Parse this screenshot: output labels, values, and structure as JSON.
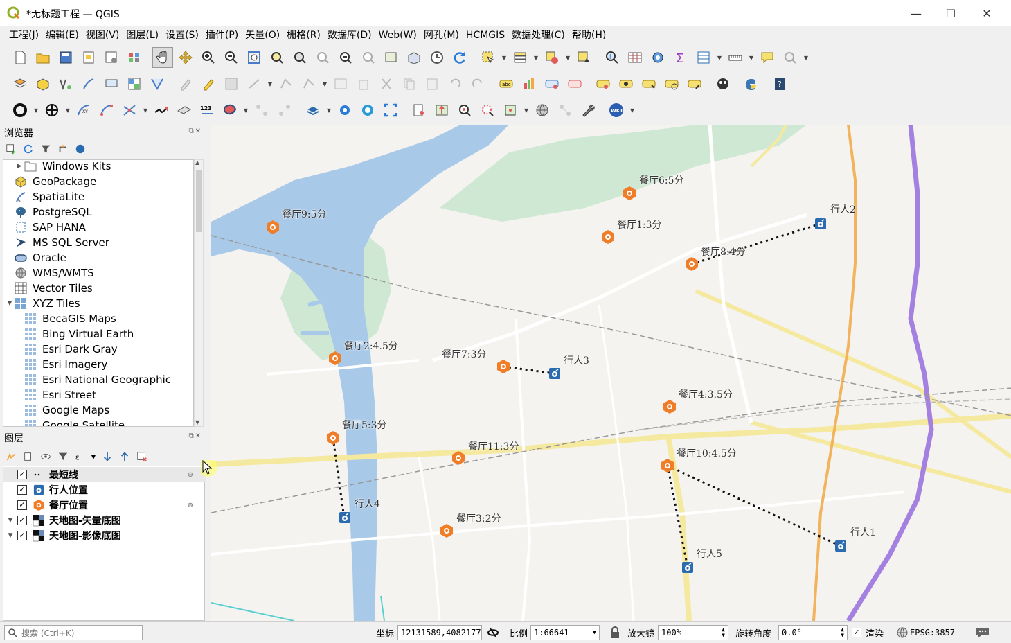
{
  "window": {
    "title": "*无标题工程 — QGIS",
    "minimize": "—",
    "maximize": "☐",
    "close": "✕"
  },
  "menu": [
    "工程(J)",
    "编辑(E)",
    "视图(V)",
    "图层(L)",
    "设置(S)",
    "插件(P)",
    "矢量(O)",
    "栅格(R)",
    "数据库(D)",
    "Web(W)",
    "网孔(M)",
    "HCMGIS",
    "数据处理(C)",
    "帮助(H)"
  ],
  "browser": {
    "title": "浏览器",
    "items": [
      {
        "label": "Windows Kits",
        "icon": "folder-icon",
        "indent": 1,
        "arrow": "▶"
      },
      {
        "label": "GeoPackage",
        "icon": "geopackage-icon",
        "indent": 0,
        "arrow": ""
      },
      {
        "label": "SpatiaLite",
        "icon": "spatialite-icon",
        "indent": 0,
        "arrow": ""
      },
      {
        "label": "PostgreSQL",
        "icon": "postgresql-icon",
        "indent": 0,
        "arrow": ""
      },
      {
        "label": "SAP HANA",
        "icon": "sap-hana-icon",
        "indent": 0,
        "arrow": ""
      },
      {
        "label": "MS SQL Server",
        "icon": "mssql-icon",
        "indent": 0,
        "arrow": ""
      },
      {
        "label": "Oracle",
        "icon": "oracle-icon",
        "indent": 0,
        "arrow": ""
      },
      {
        "label": "WMS/WMTS",
        "icon": "wms-icon",
        "indent": 0,
        "arrow": ""
      },
      {
        "label": "Vector Tiles",
        "icon": "vector-tiles-icon",
        "indent": 0,
        "arrow": ""
      },
      {
        "label": "XYZ Tiles",
        "icon": "xyz-tiles-icon",
        "indent": 0,
        "arrow": "▼"
      },
      {
        "label": "BecaGIS Maps",
        "icon": "tile-icon",
        "indent": 1,
        "arrow": ""
      },
      {
        "label": "Bing Virtual Earth",
        "icon": "tile-icon",
        "indent": 1,
        "arrow": ""
      },
      {
        "label": "Esri Dark Gray",
        "icon": "tile-icon",
        "indent": 1,
        "arrow": ""
      },
      {
        "label": "Esri Imagery",
        "icon": "tile-icon",
        "indent": 1,
        "arrow": ""
      },
      {
        "label": "Esri National Geographic",
        "icon": "tile-icon",
        "indent": 1,
        "arrow": ""
      },
      {
        "label": "Esri Street",
        "icon": "tile-icon",
        "indent": 1,
        "arrow": ""
      },
      {
        "label": "Google Maps",
        "icon": "tile-icon",
        "indent": 1,
        "arrow": ""
      },
      {
        "label": "Google Satellite",
        "icon": "tile-icon",
        "indent": 1,
        "arrow": ""
      }
    ]
  },
  "layers": {
    "title": "图层",
    "items": [
      {
        "label": "最短线",
        "icon": "dotted-line-icon",
        "checked": true,
        "arrow": ""
      },
      {
        "label": "行人位置",
        "icon": "pedestrian-icon",
        "checked": true,
        "arrow": ""
      },
      {
        "label": "餐厅位置",
        "icon": "restaurant-icon",
        "checked": true,
        "arrow": ""
      },
      {
        "label": "天地图-矢量底图",
        "icon": "raster-icon",
        "checked": true,
        "arrow": "▼"
      },
      {
        "label": "天地图-影像底图",
        "icon": "raster-icon",
        "checked": true,
        "arrow": "▼"
      }
    ]
  },
  "map": {
    "restaurants": [
      {
        "label": "餐厅6:5分"
      },
      {
        "label": "餐厅9:5分"
      },
      {
        "label": "餐厅1:3分"
      },
      {
        "label": "餐厅8:4分"
      },
      {
        "label": "餐厅2:4.5分"
      },
      {
        "label": "餐厅7:3分"
      },
      {
        "label": "餐厅4:3.5分"
      },
      {
        "label": "餐厅5:3分"
      },
      {
        "label": "餐厅11:3分"
      },
      {
        "label": "餐厅10:4.5分"
      },
      {
        "label": "餐厅3:2分"
      }
    ],
    "pedestrians": [
      {
        "label": "行人2"
      },
      {
        "label": "行人3"
      },
      {
        "label": "行人4"
      },
      {
        "label": "行人1"
      },
      {
        "label": "行人5"
      }
    ]
  },
  "status": {
    "search_placeholder": "搜索 (Ctrl+K)",
    "coord_label": "坐标",
    "coord_value": "12131589,4082177",
    "scale_label": "比例",
    "scale_value": "1:66641",
    "magnifier_label": "放大镜",
    "magnifier_value": "100%",
    "rotation_label": "旋转角度",
    "rotation_value": "0.0°",
    "render_label": "渲染",
    "crs_label": "EPSG:3857"
  },
  "colors": {
    "restaurant": "#f07d28",
    "pedestrian": "#2b6cb0",
    "water": "#a9c9e8",
    "green": "#cfe8d4",
    "purple_road": "#a480e0",
    "orange_road": "#f2b35c"
  }
}
